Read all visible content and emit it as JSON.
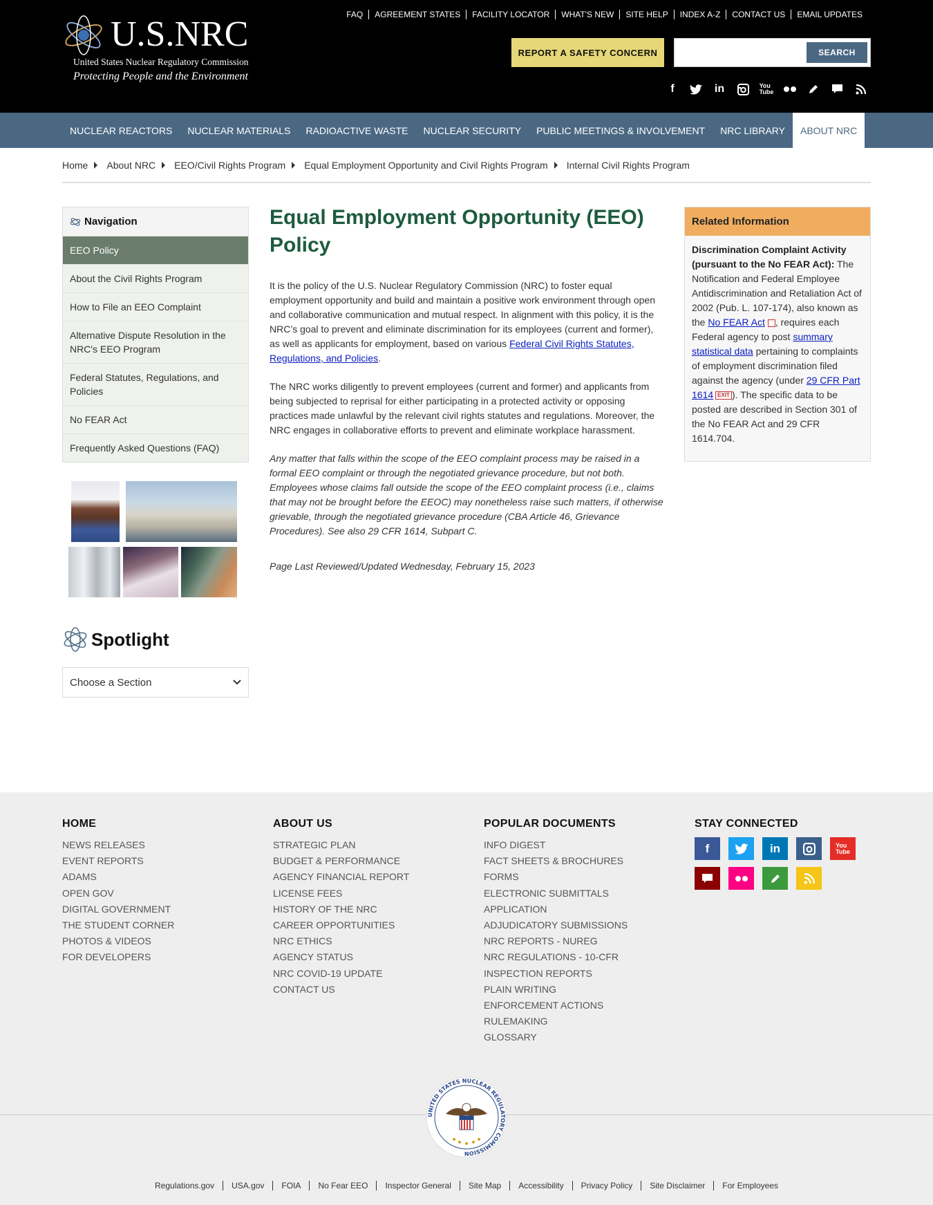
{
  "header": {
    "logo_title": "U.S.NRC",
    "logo_subtitle": "United States Nuclear Regulatory Commission",
    "logo_tagline": "Protecting People and the Environment",
    "util_links": [
      "FAQ",
      "AGREEMENT STATES",
      "FACILITY LOCATOR",
      "WHAT'S NEW",
      "SITE HELP",
      "INDEX A-Z",
      "CONTACT US",
      "EMAIL UPDATES"
    ],
    "report_label": "REPORT A SAFETY CONCERN",
    "search_value": "",
    "search_button": "SEARCH",
    "social_icons": [
      "facebook-icon",
      "twitter-icon",
      "linkedin-icon",
      "instagram-icon",
      "youtube-icon",
      "flickr-icon",
      "blog-icon",
      "comment-icon",
      "rss-icon"
    ]
  },
  "nav": {
    "items": [
      "NUCLEAR REACTORS",
      "NUCLEAR MATERIALS",
      "RADIOACTIVE WASTE",
      "NUCLEAR SECURITY",
      "PUBLIC MEETINGS & INVOLVEMENT",
      "NRC LIBRARY",
      "ABOUT NRC"
    ],
    "active": "ABOUT NRC"
  },
  "breadcrumb": [
    "Home",
    "About NRC",
    "EEO/Civil Rights Program",
    "Equal Employment Opportunity and Civil Rights Program",
    "Internal Civil Rights Program"
  ],
  "sidebar": {
    "title": "Navigation",
    "items": [
      "EEO Policy",
      "About the Civil Rights Program",
      "How to File an EEO Complaint",
      "Alternative Dispute Resolution in the NRC's EEO Program",
      "Federal Statutes, Regulations, and Policies",
      "No FEAR Act",
      "Frequently Asked Questions (FAQ)"
    ],
    "active": "EEO Policy",
    "spotlight_title": "Spotlight",
    "choose_label": "Choose a Section"
  },
  "main": {
    "title": "Equal Employment Opportunity (EEO) Policy",
    "p1_text": "It is the policy of the U.S. Nuclear Regulatory Commission (NRC) to foster equal employment opportunity and build and maintain a positive work environment through open and collaborative communication and mutual respect. In alignment with this policy, it is the NRC’s goal to prevent and eliminate discrimination for its employees (current and former), as well as applicants for employment, based on various ",
    "p1_link": "Federal Civil Rights Statutes, Regulations, and Policies",
    "p1_end": ".",
    "p2": "The NRC works diligently to prevent employees (current and former) and applicants from being subjected to reprisal for either participating in a protected activity or opposing practices made unlawful by the relevant civil rights statutes and regulations. Moreover, the NRC engages in collaborative efforts to prevent and eliminate workplace harassment.",
    "p3": "Any matter that falls within the scope of the EEO complaint process may be raised in a formal EEO complaint or through the negotiated grievance procedure, but not both. Employees whose claims fall outside the scope of the EEO complaint process (i.e., claims that may not be brought before the EEOC) may nonetheless raise such matters, if otherwise grievable, through the negotiated grievance procedure (CBA Article 46, Grievance Procedures). See also 29 CFR 1614, Subpart C.",
    "reviewed": "Page Last Reviewed/Updated Wednesday, February 15, 2023"
  },
  "related": {
    "title": "Related Information",
    "heading": "Discrimination Complaint Activity (pursuant to the No FEAR Act):",
    "t1": " The Notification and Federal Employee Antidiscrimination and Retaliation Act of 2002 (Pub. L. 107-174), also known as the ",
    "link1": "No FEAR Act",
    "t2": ", requires each Federal agency to post ",
    "link2": "summary statistical data",
    "t3": " pertaining to complaints of employment discrimination filed against the agency (under ",
    "link3": "29 CFR Part 1614",
    "exit": "EXIT",
    "t4": "). The specific data to be posted are described in Section 301 of the No FEAR Act and 29 CFR 1614.704."
  },
  "footer": {
    "home": {
      "title": "HOME",
      "links": [
        "NEWS RELEASES",
        "EVENT REPORTS",
        "ADAMS",
        "OPEN GOV",
        "DIGITAL GOVERNMENT",
        "THE STUDENT CORNER",
        "PHOTOS & VIDEOS",
        "FOR DEVELOPERS"
      ]
    },
    "about": {
      "title": "ABOUT US",
      "links": [
        "STRATEGIC PLAN",
        "BUDGET & PERFORMANCE",
        "AGENCY FINANCIAL REPORT",
        "LICENSE FEES",
        "HISTORY OF THE NRC",
        "CAREER OPPORTUNITIES",
        "NRC ETHICS",
        "AGENCY STATUS",
        "NRC COVID-19 UPDATE",
        "CONTACT US"
      ]
    },
    "popular": {
      "title": "POPULAR DOCUMENTS",
      "links": [
        "INFO DIGEST",
        "FACT SHEETS & BROCHURES",
        "FORMS",
        "ELECTRONIC SUBMITTALS",
        "APPLICATION",
        "ADJUDICATORY SUBMISSIONS",
        "NRC REPORTS - NUREG",
        "NRC REGULATIONS - 10-CFR",
        "INSPECTION REPORTS",
        "PLAIN WRITING",
        "ENFORCEMENT ACTIONS",
        "RULEMAKING",
        "GLOSSARY"
      ]
    },
    "connected": {
      "title": "STAY CONNECTED"
    },
    "social_colors": {
      "facebook": "#3b5998",
      "twitter": "#1da1f2",
      "linkedin": "#0077b5",
      "instagram": "#3a5f8a",
      "youtube": "#e52d27",
      "comment": "#8b0000",
      "flickr": "#ff0084",
      "blog": "#3c9a3c",
      "rss": "#f5c518"
    },
    "seal_text": "UNITED STATES NUCLEAR REGULATORY COMMISSION",
    "bottom_links": [
      "Regulations.gov",
      "USA.gov",
      "FOIA",
      "No Fear EEO",
      "Inspector General",
      "Site Map",
      "Accessibility",
      "Privacy Policy",
      "Site Disclaimer",
      "For Employees"
    ]
  }
}
